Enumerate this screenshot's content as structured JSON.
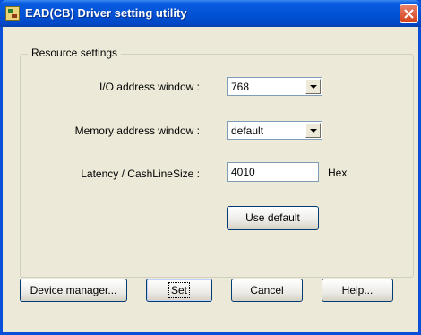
{
  "window": {
    "title": "EAD(CB) Driver setting utility"
  },
  "resource_settings": {
    "legend": "Resource settings",
    "io_address": {
      "label": "I/O address window :",
      "value": "768"
    },
    "memory_address": {
      "label": "Memory address window :",
      "value": "default"
    },
    "latency": {
      "label": "Latency / CashLineSize :",
      "value": "4010",
      "unit": "Hex"
    },
    "use_default_label": "Use default"
  },
  "buttons": {
    "device_manager": "Device manager...",
    "set": "Set",
    "cancel": "Cancel",
    "help": "Help..."
  },
  "colors": {
    "titlebar": "#0253d6",
    "dialog_bg": "#ece9d8",
    "close_button": "#d3411c"
  }
}
